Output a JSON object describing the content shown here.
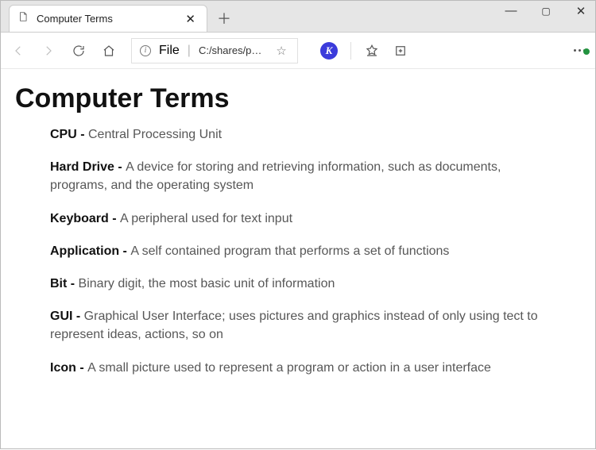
{
  "window": {
    "tab_title": "Computer Terms"
  },
  "address": {
    "scheme_label": "File",
    "path": "C:/shares/p…"
  },
  "page": {
    "heading": "Computer Terms",
    "terms": [
      {
        "name": "CPU",
        "def": "Central Processing Unit"
      },
      {
        "name": "Hard Drive",
        "def": "A device for storing and retrieving information, such as documents, programs, and the operating system"
      },
      {
        "name": "Keyboard",
        "def": "A peripheral used for text input"
      },
      {
        "name": "Application",
        "def": "A self contained program that performs a set of functions"
      },
      {
        "name": "Bit",
        "def": "Binary digit, the most basic unit of information"
      },
      {
        "name": "GUI",
        "def": "Graphical User Interface; uses pictures and graphics instead of only using tect to represent ideas, actions, so on"
      },
      {
        "name": "Icon",
        "def": "A small picture used to represent a program or action in a user interface"
      }
    ]
  }
}
